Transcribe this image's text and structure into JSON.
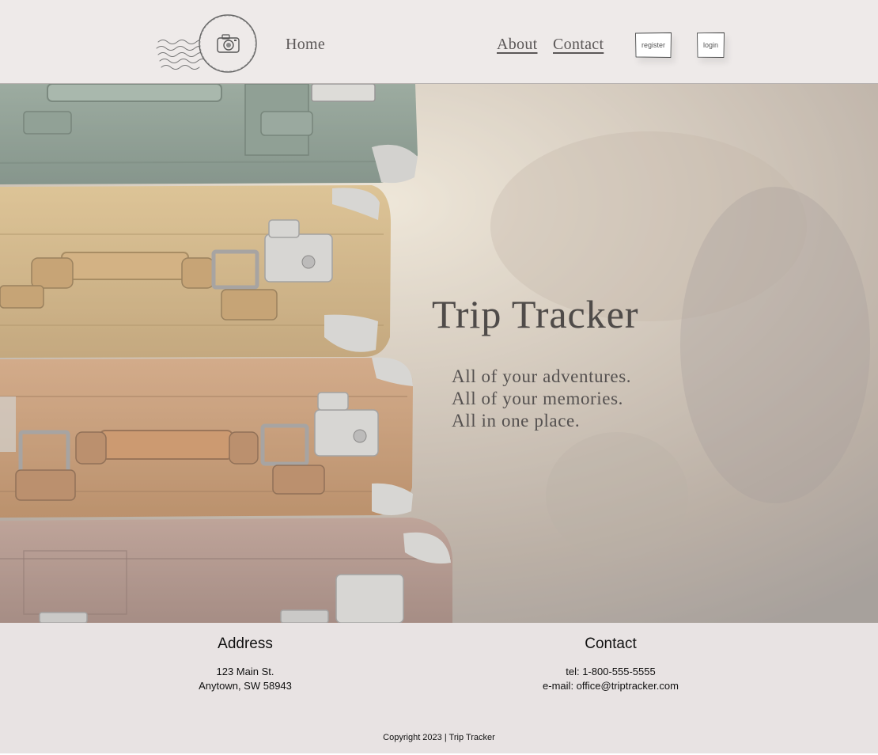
{
  "nav": {
    "home_label": "Home",
    "about_label": "About",
    "contact_label": "Contact",
    "register_label": "register",
    "login_label": "login",
    "logo_icon": "camera-postmark-icon"
  },
  "hero": {
    "title": "Trip Tracker",
    "tagline_1": "All of your adventures.",
    "tagline_2": "All of your memories.",
    "tagline_3": "All in one place."
  },
  "footer": {
    "address_heading": "Address",
    "address_line_1": "123 Main St.",
    "address_line_2": "Anytown, SW 58943",
    "contact_heading": "Contact",
    "contact_tel": "tel: 1-800-555-5555",
    "contact_email": "e-mail: office@triptracker.com",
    "copyright": "Copyright 2023 | Trip Tracker"
  },
  "colors": {
    "header_bg": "#eeeae9",
    "footer_bg": "#e8e3e3",
    "title_text": "#4f4b49"
  }
}
